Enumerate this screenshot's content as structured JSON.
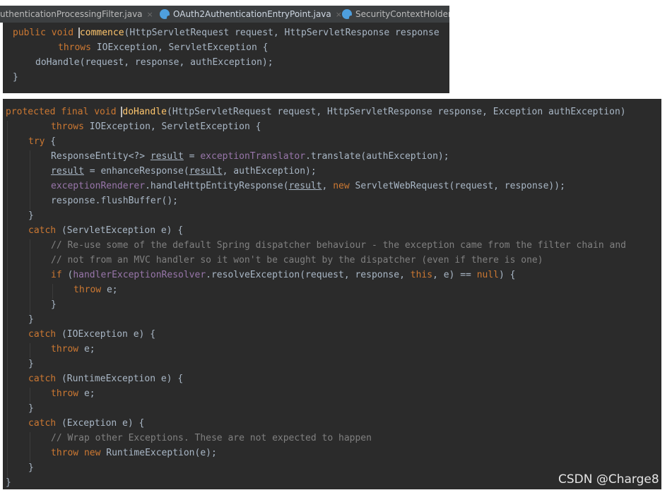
{
  "tabs": [
    {
      "label": "uthenticationProcessingFilter.java",
      "close": "×"
    },
    {
      "label": "OAuth2AuthenticationEntryPoint.java",
      "close": "×"
    },
    {
      "label": "SecurityContextHolder."
    }
  ],
  "top_code": {
    "l1": {
      "mod": "public void ",
      "name_first": "c",
      "name_rest": "ommence",
      "params": "(HttpServletRequest request, HttpServletResponse response"
    },
    "l2": {
      "kw": "throws ",
      "rest": "IOException, ServletException {"
    },
    "l3": {
      "text": "doHandle(request, response, authException);"
    },
    "l4": {
      "text": "}"
    }
  },
  "main_code": {
    "l1": {
      "mod": "protected final void ",
      "name_first": "d",
      "name_rest": "oHandle",
      "params": "(HttpServletRequest request, HttpServletResponse response, Exception authException)"
    },
    "l2": {
      "kw": "throws ",
      "rest": "IOException, ServletException {"
    },
    "l3": {
      "kw": "try",
      "rest": " {"
    },
    "l4": {
      "a": "ResponseEntity<?> ",
      "v": "result",
      "b": " = ",
      "f": "exceptionTranslator",
      "c": ".translate(authException);"
    },
    "l5": {
      "v": "result",
      "a": " = enhanceResponse(",
      "v2": "result",
      "b": ", authException);"
    },
    "l6": {
      "f": "exceptionRenderer",
      "a": ".handleHttpEntityResponse(",
      "v": "result",
      "b": ", ",
      "kw": "new",
      "c": " ServletWebRequest(request, response));"
    },
    "l7": {
      "text": "response.flushBuffer();"
    },
    "l8": {
      "text": "}"
    },
    "l9": {
      "kw": "catch",
      "rest": " (ServletException e) {"
    },
    "l10": {
      "text": "// Re-use some of the default Spring dispatcher behaviour - the exception came from the filter chain and"
    },
    "l11": {
      "text": "// not from an MVC handler so it won't be caught by the dispatcher (even if there is one)"
    },
    "l12": {
      "kw": "if",
      "a": " (",
      "f": "handlerExceptionResolver",
      "b": ".resolveException(request, response, ",
      "kw2": "this",
      "c": ", e) == ",
      "kw3": "null",
      "d": ") {"
    },
    "l13": {
      "kw": "throw",
      "rest": " e;"
    },
    "l14": {
      "text": "}"
    },
    "l15": {
      "text": "}"
    },
    "l16": {
      "kw": "catch",
      "rest": " (IOException e) {"
    },
    "l17": {
      "kw": "throw",
      "rest": " e;"
    },
    "l18": {
      "text": "}"
    },
    "l19": {
      "kw": "catch",
      "rest": " (RuntimeException e) {"
    },
    "l20": {
      "kw": "throw",
      "rest": " e;"
    },
    "l21": {
      "text": "}"
    },
    "l22": {
      "kw": "catch",
      "rest": " (Exception e) {"
    },
    "l23": {
      "text": "// Wrap other Exceptions. These are not expected to happen"
    },
    "l24": {
      "kw": "throw new",
      "rest": " RuntimeException(e);"
    },
    "l25": {
      "text": "}"
    },
    "l26": {
      "text": "}"
    }
  },
  "watermark": "CSDN @Charge8",
  "colors": {
    "background": "#2b2b2b",
    "keyword": "#cc7832",
    "method": "#ffc66d",
    "field": "#9876aa",
    "comment": "#808080",
    "text": "#a9b7c6"
  },
  "icons": {
    "tab_file": "java-class-icon"
  }
}
